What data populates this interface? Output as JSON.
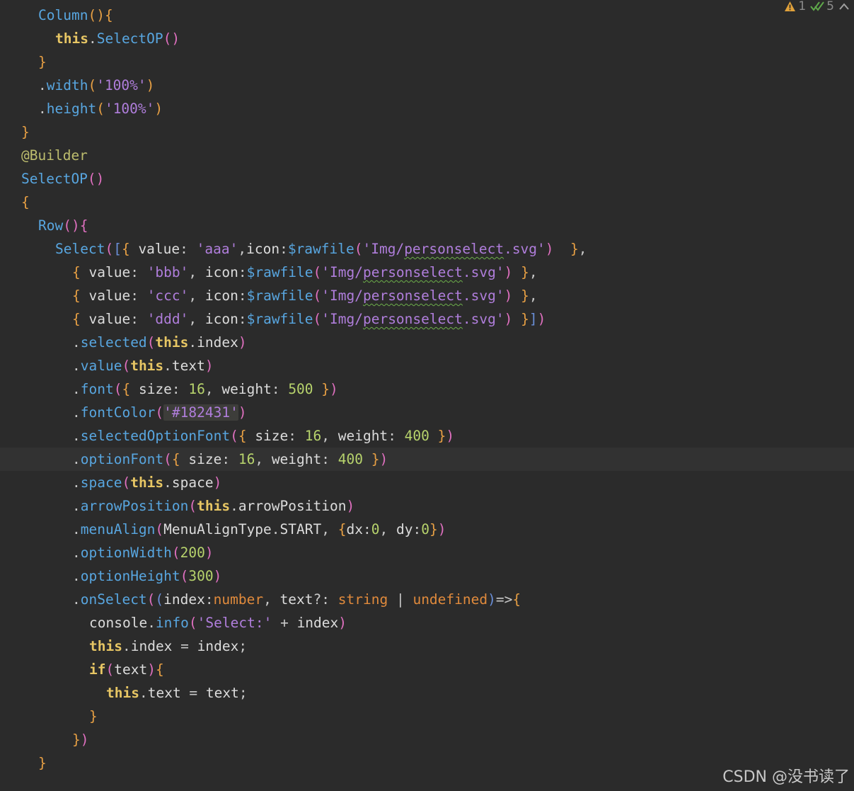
{
  "inspection": {
    "warnings_count": "1",
    "weak_warnings_count": "5",
    "warning_icon": "warning-triangle-icon",
    "weak_warning_icon": "double-check-icon",
    "collapse_icon": "chevron-up-icon"
  },
  "watermark": "CSDN @没书读了",
  "colors": {
    "background": "#2b2b2b",
    "current_line": "#323232",
    "keyword": "#e7c664",
    "function": "#58a6e0",
    "string": "#b07edc",
    "number": "#b7d36c",
    "type": "#e08a3c"
  },
  "current_line": 19,
  "lines": [
    {
      "indent": 2,
      "tokens": [
        [
          "Column",
          "fn"
        ],
        [
          "()",
          "p1"
        ],
        [
          "{",
          "p1"
        ]
      ]
    },
    {
      "indent": 3,
      "tokens": [
        [
          "this",
          "kw"
        ],
        [
          ".",
          "op"
        ],
        [
          "SelectOP",
          "fn"
        ],
        [
          "()",
          "p2"
        ]
      ]
    },
    {
      "indent": 2,
      "tokens": [
        [
          "}",
          "p1"
        ]
      ]
    },
    {
      "indent": 2,
      "tokens": [
        [
          ".",
          "op"
        ],
        [
          "width",
          "fn"
        ],
        [
          "(",
          "p1"
        ],
        [
          "'100%'",
          "str"
        ],
        [
          ")",
          "p1"
        ]
      ]
    },
    {
      "indent": 2,
      "tokens": [
        [
          ".",
          "op"
        ],
        [
          "height",
          "fn"
        ],
        [
          "(",
          "p1"
        ],
        [
          "'100%'",
          "str"
        ],
        [
          ")",
          "p1"
        ]
      ]
    },
    {
      "indent": 1,
      "tokens": [
        [
          "}",
          "p1"
        ]
      ]
    },
    {
      "indent": 1,
      "tokens": [
        [
          "@Builder",
          "dec"
        ]
      ]
    },
    {
      "indent": 1,
      "tokens": [
        [
          "SelectOP",
          "fn"
        ],
        [
          "()",
          "p2"
        ]
      ]
    },
    {
      "indent": 1,
      "tokens": [
        [
          "{",
          "p1"
        ]
      ]
    },
    {
      "indent": 2,
      "tokens": [
        [
          "Row",
          "fn"
        ],
        [
          "()",
          "p2"
        ],
        [
          "{",
          "p2"
        ]
      ]
    },
    {
      "indent": 3,
      "tokens": [
        [
          "Select",
          "fn"
        ],
        [
          "(",
          "p2"
        ],
        [
          "[",
          "p3"
        ],
        [
          "{",
          "p1"
        ],
        [
          " value",
          "id"
        ],
        [
          ": ",
          "op"
        ],
        [
          "'aaa'",
          "str"
        ],
        [
          ",",
          "op"
        ],
        [
          "icon",
          "id"
        ],
        [
          ":",
          "op"
        ],
        [
          "$rawfile",
          "fn"
        ],
        [
          "(",
          "p2"
        ],
        [
          "'Img/",
          "str"
        ],
        [
          "personselect",
          "str squig"
        ],
        [
          ".svg'",
          "str"
        ],
        [
          ")",
          "p2"
        ],
        [
          "  ",
          "op"
        ],
        [
          "}",
          "p1"
        ],
        [
          ",",
          "op"
        ]
      ]
    },
    {
      "indent": 4,
      "tokens": [
        [
          "{",
          "p1"
        ],
        [
          " value",
          "id"
        ],
        [
          ": ",
          "op"
        ],
        [
          "'bbb'",
          "str"
        ],
        [
          ", ",
          "op"
        ],
        [
          "icon",
          "id"
        ],
        [
          ":",
          "op"
        ],
        [
          "$rawfile",
          "fn"
        ],
        [
          "(",
          "p2"
        ],
        [
          "'Img/",
          "str"
        ],
        [
          "personselect",
          "str squig"
        ],
        [
          ".svg'",
          "str"
        ],
        [
          ")",
          "p2"
        ],
        [
          " ",
          "op"
        ],
        [
          "}",
          "p1"
        ],
        [
          ",",
          "op"
        ]
      ]
    },
    {
      "indent": 4,
      "tokens": [
        [
          "{",
          "p1"
        ],
        [
          " value",
          "id"
        ],
        [
          ": ",
          "op"
        ],
        [
          "'ccc'",
          "str"
        ],
        [
          ", ",
          "op"
        ],
        [
          "icon",
          "id"
        ],
        [
          ":",
          "op"
        ],
        [
          "$rawfile",
          "fn"
        ],
        [
          "(",
          "p2"
        ],
        [
          "'Img/",
          "str"
        ],
        [
          "personselect",
          "str squig"
        ],
        [
          ".svg'",
          "str"
        ],
        [
          ")",
          "p2"
        ],
        [
          " ",
          "op"
        ],
        [
          "}",
          "p1"
        ],
        [
          ",",
          "op"
        ]
      ]
    },
    {
      "indent": 4,
      "tokens": [
        [
          "{",
          "p1"
        ],
        [
          " value",
          "id"
        ],
        [
          ": ",
          "op"
        ],
        [
          "'ddd'",
          "str"
        ],
        [
          ", ",
          "op"
        ],
        [
          "icon",
          "id"
        ],
        [
          ":",
          "op"
        ],
        [
          "$rawfile",
          "fn"
        ],
        [
          "(",
          "p2"
        ],
        [
          "'Img/",
          "str"
        ],
        [
          "personselect",
          "str squig"
        ],
        [
          ".svg'",
          "str"
        ],
        [
          ")",
          "p2"
        ],
        [
          " ",
          "op"
        ],
        [
          "}",
          "p1"
        ],
        [
          "]",
          "p3"
        ],
        [
          ")",
          "p2"
        ]
      ]
    },
    {
      "indent": 4,
      "tokens": [
        [
          ".",
          "op"
        ],
        [
          "selected",
          "fn"
        ],
        [
          "(",
          "p2"
        ],
        [
          "this",
          "kw"
        ],
        [
          ".",
          "op"
        ],
        [
          "index",
          "id"
        ],
        [
          ")",
          "p2"
        ]
      ]
    },
    {
      "indent": 4,
      "tokens": [
        [
          ".",
          "op"
        ],
        [
          "value",
          "fn"
        ],
        [
          "(",
          "p2"
        ],
        [
          "this",
          "kw"
        ],
        [
          ".",
          "op"
        ],
        [
          "text",
          "id"
        ],
        [
          ")",
          "p2"
        ]
      ]
    },
    {
      "indent": 4,
      "tokens": [
        [
          ".",
          "op"
        ],
        [
          "font",
          "fn"
        ],
        [
          "(",
          "p2"
        ],
        [
          "{",
          "p1"
        ],
        [
          " size",
          "id"
        ],
        [
          ": ",
          "op"
        ],
        [
          "16",
          "num"
        ],
        [
          ", ",
          "op"
        ],
        [
          "weight",
          "id"
        ],
        [
          ": ",
          "op"
        ],
        [
          "500",
          "num"
        ],
        [
          " ",
          "op"
        ],
        [
          "}",
          "p1"
        ],
        [
          ")",
          "p2"
        ]
      ]
    },
    {
      "indent": 4,
      "tokens": [
        [
          ".",
          "op"
        ],
        [
          "fontColor",
          "fn"
        ],
        [
          "(",
          "p2"
        ],
        [
          "'#182431'",
          "str hl"
        ],
        [
          ")",
          "p2"
        ]
      ]
    },
    {
      "indent": 4,
      "tokens": [
        [
          ".",
          "op"
        ],
        [
          "selectedOptionFont",
          "fn"
        ],
        [
          "(",
          "p2"
        ],
        [
          "{",
          "p1"
        ],
        [
          " size",
          "id"
        ],
        [
          ": ",
          "op"
        ],
        [
          "16",
          "num"
        ],
        [
          ", ",
          "op"
        ],
        [
          "weight",
          "id"
        ],
        [
          ": ",
          "op"
        ],
        [
          "400",
          "num"
        ],
        [
          " ",
          "op"
        ],
        [
          "}",
          "p1"
        ],
        [
          ")",
          "p2"
        ]
      ]
    },
    {
      "indent": 4,
      "tokens": [
        [
          ".",
          "op"
        ],
        [
          "optionFont",
          "fn"
        ],
        [
          "(",
          "p2"
        ],
        [
          "{",
          "p1"
        ],
        [
          " size",
          "id"
        ],
        [
          ": ",
          "op"
        ],
        [
          "16",
          "num"
        ],
        [
          ", ",
          "op"
        ],
        [
          "weight",
          "id"
        ],
        [
          ": ",
          "op"
        ],
        [
          "400",
          "num"
        ],
        [
          " ",
          "op"
        ],
        [
          "}",
          "p1"
        ],
        [
          ")",
          "p2"
        ]
      ]
    },
    {
      "indent": 4,
      "tokens": [
        [
          ".",
          "op"
        ],
        [
          "space",
          "fn"
        ],
        [
          "(",
          "p2"
        ],
        [
          "this",
          "kw"
        ],
        [
          ".",
          "op"
        ],
        [
          "space",
          "id"
        ],
        [
          ")",
          "p2"
        ]
      ]
    },
    {
      "indent": 4,
      "tokens": [
        [
          ".",
          "op"
        ],
        [
          "arrowPosition",
          "fn"
        ],
        [
          "(",
          "p2"
        ],
        [
          "this",
          "kw"
        ],
        [
          ".",
          "op"
        ],
        [
          "arrowPosition",
          "id"
        ],
        [
          ")",
          "p2"
        ]
      ]
    },
    {
      "indent": 4,
      "tokens": [
        [
          ".",
          "op"
        ],
        [
          "menuAlign",
          "fn"
        ],
        [
          "(",
          "p2"
        ],
        [
          "MenuAlignType",
          "id"
        ],
        [
          ".",
          "op"
        ],
        [
          "START",
          "id"
        ],
        [
          ", ",
          "op"
        ],
        [
          "{",
          "p1"
        ],
        [
          "dx",
          "id"
        ],
        [
          ":",
          "op"
        ],
        [
          "0",
          "num"
        ],
        [
          ", ",
          "op"
        ],
        [
          "dy",
          "id"
        ],
        [
          ":",
          "op"
        ],
        [
          "0",
          "num"
        ],
        [
          "}",
          "p1"
        ],
        [
          ")",
          "p2"
        ]
      ]
    },
    {
      "indent": 4,
      "tokens": [
        [
          ".",
          "op"
        ],
        [
          "optionWidth",
          "fn"
        ],
        [
          "(",
          "p2"
        ],
        [
          "200",
          "num"
        ],
        [
          ")",
          "p2"
        ]
      ]
    },
    {
      "indent": 4,
      "tokens": [
        [
          ".",
          "op"
        ],
        [
          "optionHeight",
          "fn"
        ],
        [
          "(",
          "p2"
        ],
        [
          "300",
          "num"
        ],
        [
          ")",
          "p2"
        ]
      ]
    },
    {
      "indent": 4,
      "tokens": [
        [
          ".",
          "op"
        ],
        [
          "onSelect",
          "fn"
        ],
        [
          "(",
          "p2"
        ],
        [
          "(",
          "p3"
        ],
        [
          "index",
          "id"
        ],
        [
          ":",
          "op"
        ],
        [
          "number",
          "type"
        ],
        [
          ", ",
          "op"
        ],
        [
          "text",
          "id"
        ],
        [
          "?: ",
          "op"
        ],
        [
          "string",
          "type"
        ],
        [
          " | ",
          "op"
        ],
        [
          "undefined",
          "type"
        ],
        [
          ")",
          "p3"
        ],
        [
          "=>",
          "op"
        ],
        [
          "{",
          "p1"
        ]
      ]
    },
    {
      "indent": 5,
      "tokens": [
        [
          "console",
          "id"
        ],
        [
          ".",
          "op"
        ],
        [
          "info",
          "fn"
        ],
        [
          "(",
          "p2"
        ],
        [
          "'Select:'",
          "str"
        ],
        [
          " + ",
          "op"
        ],
        [
          "index",
          "id"
        ],
        [
          ")",
          "p2"
        ]
      ]
    },
    {
      "indent": 5,
      "tokens": [
        [
          "this",
          "kw"
        ],
        [
          ".",
          "op"
        ],
        [
          "index",
          "id"
        ],
        [
          " = ",
          "op"
        ],
        [
          "index",
          "id"
        ],
        [
          ";",
          "op"
        ]
      ]
    },
    {
      "indent": 5,
      "tokens": [
        [
          "if",
          "kw"
        ],
        [
          "(",
          "p2"
        ],
        [
          "text",
          "id"
        ],
        [
          ")",
          "p2"
        ],
        [
          "{",
          "p1"
        ]
      ]
    },
    {
      "indent": 6,
      "tokens": [
        [
          "this",
          "kw"
        ],
        [
          ".",
          "op"
        ],
        [
          "text",
          "id"
        ],
        [
          " = ",
          "op"
        ],
        [
          "text",
          "id"
        ],
        [
          ";",
          "op"
        ]
      ]
    },
    {
      "indent": 5,
      "tokens": [
        [
          "}",
          "p1"
        ]
      ]
    },
    {
      "indent": 4,
      "tokens": [
        [
          "}",
          "p1"
        ],
        [
          ")",
          "p2"
        ]
      ]
    },
    {
      "indent": 2,
      "tokens": [
        [
          "}",
          "p1"
        ]
      ]
    }
  ]
}
